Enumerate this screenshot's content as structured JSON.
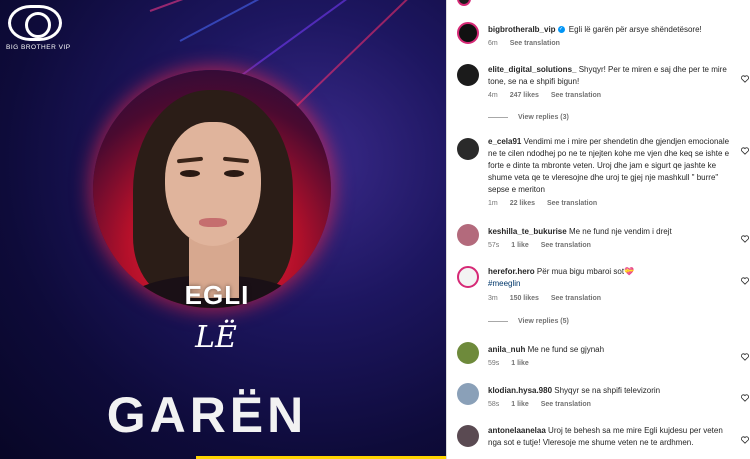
{
  "post": {
    "logo_caption": "BIG BROTHER VIP",
    "name_line1": "EGLI",
    "name_line2": "LË",
    "name_line3": "GARËN"
  },
  "caption": {
    "username": "bigbrotheralb_vip",
    "text": "Egli lë garën për arsye shëndetësore!",
    "time": "6m",
    "translation": "See translation"
  },
  "comments": [
    {
      "username": "elite_digital_solutions_",
      "text": "Shyqyr! Per te miren e saj dhe per te mire tone, se na e shpifi bigun!",
      "time": "4m",
      "likes": "247 likes",
      "translation": "See translation",
      "replies": "View replies (3)"
    },
    {
      "username": "e_cela91",
      "text": "Vendimi me i mire per shendetin dhe gjendjen emocionale ne te cilen ndodhej po ne te njejten kohe me vjen dhe keq se ishte e forte e dinte ta mbronte veten. Uroj dhe jam e sigurt qe jashte ke shume veta qe te vleresojne dhe uroj te gjej nje mashkull \" burre\" sepse e meriton",
      "time": "1m",
      "likes": "22 likes",
      "translation": "See translation"
    },
    {
      "username": "keshilla_te_bukurise",
      "text": "Me ne fund nje vendim i drejt",
      "time": "57s",
      "likes": "1 like",
      "translation": "See translation"
    },
    {
      "username": "herefor.hero",
      "text": "Për mua bigu mbaroi sot💝",
      "hashtag": "#meeglin",
      "time": "3m",
      "likes": "150 likes",
      "translation": "See translation",
      "replies": "View replies (5)"
    },
    {
      "username": "anila_nuh",
      "text": "Me ne fund se gjynah",
      "time": "59s",
      "likes": "1 like"
    },
    {
      "username": "klodian.hysa.980",
      "text": "Shyqyr se na shpifi televizorin",
      "time": "58s",
      "likes": "1 like",
      "translation": "See translation"
    },
    {
      "username": "antonelaanelaa",
      "text": "Uroj te behesh sa me mire Egli kujdesu per veten nga sot e tutje! Vleresoje me shume veten ne te ardhmen."
    }
  ],
  "colors": {
    "accent_red": "#ff2840",
    "background_navy": "#0e0b3a",
    "verified_blue": "#0095f6",
    "highlight_yellow": "#ffd400"
  }
}
